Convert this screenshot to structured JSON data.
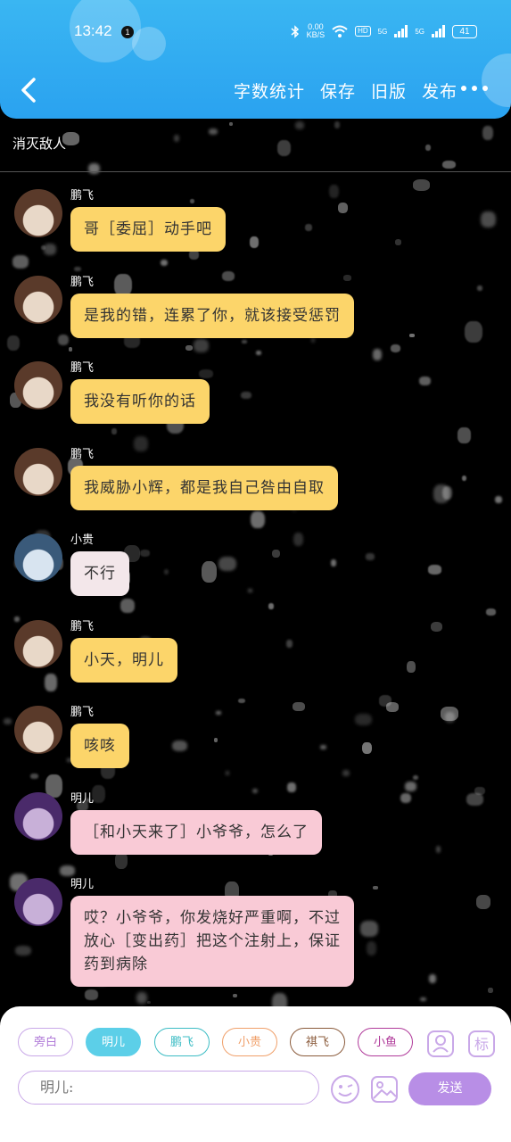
{
  "status_bar": {
    "time": "13:42",
    "notification_count": "1",
    "net_speed": "0.00",
    "net_unit": "KB/S",
    "hd": "HD",
    "sig1": "5G",
    "sig2": "5G",
    "battery": "41"
  },
  "toolbar": {
    "word_count": "字数统计",
    "save": "保存",
    "old_version": "旧版",
    "publish": "发布"
  },
  "scene_title": "消灭敌人",
  "messages": [
    {
      "sender": "鹏飞",
      "text": "哥［委屈］动手吧",
      "style": "yellow"
    },
    {
      "sender": "鹏飞",
      "text": "是我的错，连累了你，就该接受惩罚",
      "style": "yellow"
    },
    {
      "sender": "鹏飞",
      "text": "我没有听你的话",
      "style": "yellow"
    },
    {
      "sender": "鹏飞",
      "text": "我威胁小辉，都是我自己咎由自取",
      "style": "yellow"
    },
    {
      "sender": "小贵",
      "text": "不行",
      "style": "gray"
    },
    {
      "sender": "鹏飞",
      "text": "小天，明儿",
      "style": "yellow"
    },
    {
      "sender": "鹏飞",
      "text": "咳咳",
      "style": "yellow"
    },
    {
      "sender": "明儿",
      "text": "［和小天来了］小爷爷，怎么了",
      "style": "pink"
    },
    {
      "sender": "明儿",
      "text_lines": [
        "哎？小爷爷，你发烧好严重啊，不过",
        "放心［变出药］把这个注射上，保证",
        "药到病除"
      ],
      "style": "pink"
    }
  ],
  "characters": [
    {
      "label": "旁白",
      "color": "#c9a8e8",
      "text_color": "#b07ad8"
    },
    {
      "label": "明儿",
      "color": "#5ccfe8",
      "text_color": "#ffffff",
      "selected": true
    },
    {
      "label": "鹏飞",
      "color": "#3bbcc4",
      "text_color": "#3bbcc4"
    },
    {
      "label": "小贵",
      "color": "#f0a06a",
      "text_color": "#f0a06a"
    },
    {
      "label": "祺飞",
      "color": "#8a5a3a",
      "text_color": "#8a5a3a"
    },
    {
      "label": "小鱼",
      "color": "#b03a9a",
      "text_color": "#b03a9a"
    }
  ],
  "input": {
    "prefix": "明儿:"
  },
  "send_label": "发送",
  "icons": [
    "back-arrow-icon",
    "more-dots-icon",
    "character-manage-icon",
    "tag-icon",
    "emoji-icon",
    "image-icon"
  ],
  "colors": {
    "header": "#2aa2f0",
    "bubble_yellow": "#fcd56a",
    "bubble_pink": "#f9cad6",
    "bubble_gray": "#f3e7ea",
    "send": "#b88ee6"
  }
}
